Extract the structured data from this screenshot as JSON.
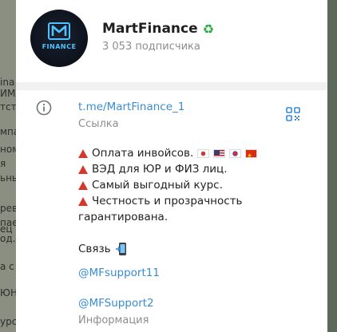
{
  "channel": {
    "name": "MartFinance",
    "name_badge_icon": "recycle-icon",
    "subscribers": "3 053 подписчика",
    "avatar_text": "FINANCE"
  },
  "info": {
    "link": "t.me/MartFinance_1",
    "link_caption": "Ссылка",
    "description_lines": [
      "Оплата инвойсов.",
      "ВЭД для ЮР и ФИЗ лиц.",
      "Самый выгодный курс.",
      "Честность и прозрачность",
      "гарантирована."
    ],
    "contact_label": "Связь",
    "handle_1": "@MFsupport11",
    "handle_2": "@MFSupport2",
    "description_caption": "Информация"
  },
  "background_chat": {
    "fragments": [
      "ina",
      "ИМА",
      "тств",
      "мпа",
      "ном",
      "я",
      "ьны",
      "рев",
      "пае",
      "ец",
      "од.",
      "а с н",
      "ЮН",
      "урс"
    ]
  },
  "colors": {
    "link": "#3a8ccf",
    "caption": "#8d8d8d",
    "triangle": "#d23a2d",
    "recycle": "#1ea836"
  }
}
